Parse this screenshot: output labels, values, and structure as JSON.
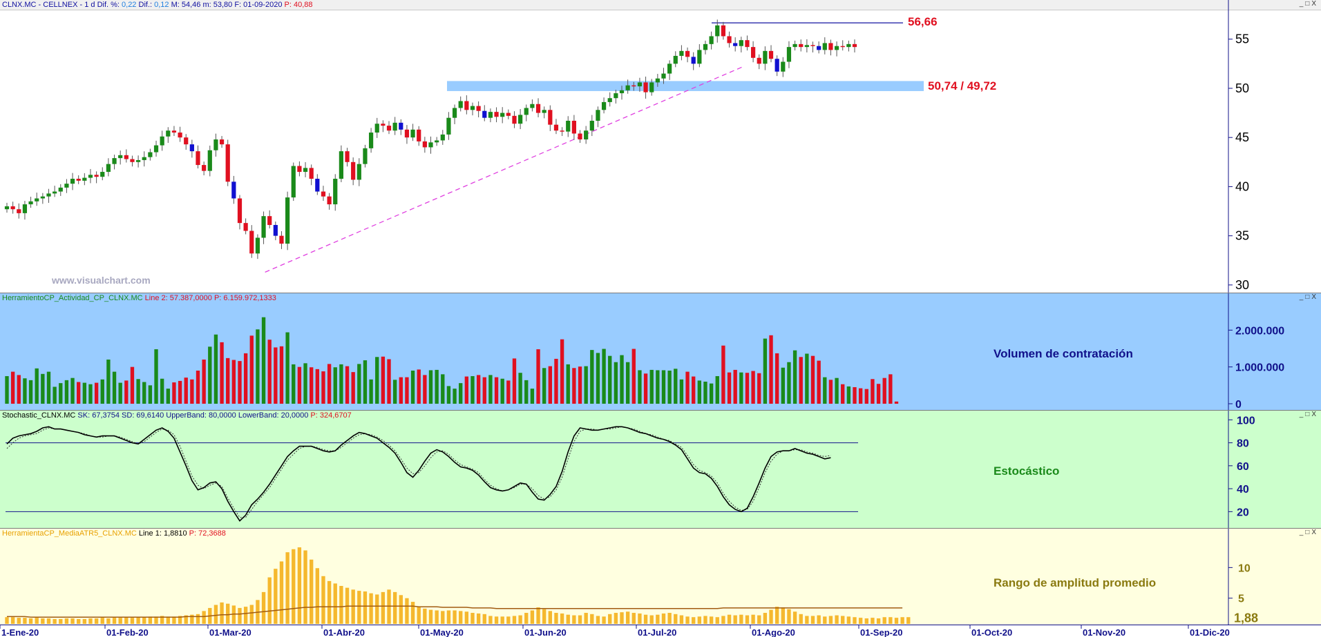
{
  "header": {
    "symbol": "CLNX.MC - CELLNEX - ",
    "period": " 1 d ",
    "dif_pct_label": "Dif. %: ",
    "dif_pct": "0,22",
    "dif_label": " Dif.: ",
    "dif": "0,12",
    "max_label": " M: ",
    "max": "54,46",
    "min_label": " m: ",
    "min": "53,80",
    "date_label": " F: ",
    "date": "01-09-2020",
    "p_label": " P: ",
    "p": "40,88"
  },
  "window_buttons": [
    "_",
    "□",
    "X"
  ],
  "watermark": "www.visualchart.com",
  "annotations": {
    "high_label": "56,66",
    "zone_label": "50,74 / 49,72"
  },
  "panels": {
    "volume": {
      "header": "HerramientoCP_Actividad_CP_CLNX.MC",
      "line_label": " Line 2: 57.387,0000",
      "p_label": " P: 6.159.972,1333",
      "title": "Volumen de contratación",
      "ticks": [
        "2.000.000",
        "1.000.000",
        "0"
      ]
    },
    "stochastic": {
      "header": "Stochastic_CLNX.MC",
      "sk_label": " SK: 67,3754  SD: 69,6140  UpperBand: 80,0000  LowerBand: 20,0000",
      "p_label": " P: 324,6707",
      "title": "Estocástico",
      "ticks": [
        "100",
        "80",
        "60",
        "40",
        "20"
      ]
    },
    "atr": {
      "header": "HerramientaCP_MediaATR5_CLNX.MC",
      "line_label": " Line 1: 1,8810",
      "p_label": " P: 72,3688",
      "title": "Rango de amplitud promedio",
      "ticks": [
        "10",
        "5"
      ],
      "last_value": "1,88"
    }
  },
  "x_axis": {
    "labels": [
      "1-Ene-20",
      "01-Feb-20",
      "01-Mar-20",
      "01-Abr-20",
      "01-May-20",
      "01-Jun-20",
      "01-Jul-20",
      "01-Ago-20",
      "01-Sep-20",
      "01-Oct-20",
      "01-Nov-20",
      "01-Dic-20"
    ]
  },
  "colors": {
    "up": "#1a8a1a",
    "down": "#e01020",
    "down_blue": "#1010d0",
    "volume_bg": "#99ccff",
    "stoch_bg": "#ccffcc",
    "atr_bg": "#ffffe0",
    "atr_bar": "#f5b82e",
    "zone": "#99ccff",
    "trend": "#e040e0",
    "label_red": "#e01020"
  },
  "chart_data": [
    {
      "type": "candlestick",
      "title": "CLNX.MC - CELLNEX",
      "y_ticks": [
        30,
        35,
        40,
        45,
        50,
        55
      ],
      "ylim": [
        29.5,
        58
      ],
      "x_range": [
        "2020-01-02",
        "2020-09-01"
      ],
      "horizontal_line": 56.66,
      "support_zone": [
        49.72,
        50.74
      ],
      "trendline": [
        [
          31.3,
          "2020-03-16"
        ],
        [
          52.2,
          "2020-07-31"
        ]
      ],
      "close": [
        38.0,
        37.7,
        37.3,
        38.2,
        38.5,
        38.8,
        39.0,
        39.3,
        39.5,
        39.9,
        40.3,
        40.8,
        40.6,
        40.9,
        41.2,
        41.0,
        41.5,
        42.3,
        42.9,
        43.2,
        42.8,
        42.5,
        42.7,
        43.0,
        43.5,
        44.2,
        45.1,
        45.7,
        45.5,
        45.0,
        44.3,
        43.6,
        42.2,
        41.6,
        43.7,
        44.8,
        44.3,
        40.5,
        38.8,
        36.3,
        35.5,
        33.2,
        34.8,
        37.0,
        36.1,
        35.0,
        34.2,
        38.9,
        42.1,
        41.5,
        41.9,
        40.8,
        39.5,
        39.0,
        38.2,
        40.8,
        43.6,
        42.5,
        40.7,
        42.3,
        43.9,
        45.5,
        46.4,
        46.2,
        45.7,
        46.5,
        45.8,
        45.0,
        45.8,
        44.6,
        44.0,
        44.5,
        44.7,
        45.3,
        47.0,
        48.0,
        48.7,
        47.8,
        48.2,
        47.7,
        47.0,
        47.6,
        47.1,
        47.5,
        47.2,
        46.4,
        47.3,
        48.0,
        48.4,
        47.5,
        47.8,
        46.3,
        45.7,
        45.6,
        46.7,
        45.4,
        44.8,
        45.7,
        46.7,
        47.8,
        48.6,
        49.0,
        49.5,
        49.8,
        50.3,
        50.2,
        50.6,
        49.6,
        50.6,
        51.0,
        51.5,
        52.5,
        53.3,
        53.8,
        53.2,
        52.5,
        53.9,
        54.5,
        55.3,
        56.4,
        55.3,
        54.6,
        54.3,
        54.9,
        54.2,
        53.1,
        52.5,
        53.8,
        53.0,
        51.7,
        52.7,
        54.2,
        54.5,
        54.2,
        54.4,
        54.3,
        53.9,
        54.6,
        53.9,
        54.3,
        54.2,
        54.5,
        54.2
      ]
    },
    {
      "type": "bar",
      "title": "Volumen de contratación",
      "ylim": [
        0,
        2700000
      ],
      "y_ticks": [
        0,
        1000000,
        2000000
      ],
      "values": [
        750000,
        870000,
        780000,
        690000,
        640000,
        960000,
        810000,
        870000,
        460000,
        560000,
        640000,
        700000,
        590000,
        570000,
        530000,
        570000,
        660000,
        1200000,
        870000,
        570000,
        630000,
        1000000,
        670000,
        590000,
        500000,
        1480000,
        680000,
        410000,
        580000,
        620000,
        710000,
        660000,
        900000,
        1200000,
        1550000,
        1880000,
        1670000,
        1240000,
        1190000,
        1160000,
        1370000,
        1850000,
        2020000,
        2350000,
        1740000,
        1530000,
        1560000,
        1940000,
        1070000,
        1000000,
        1100000,
        990000,
        940000,
        880000,
        1080000,
        990000,
        1070000,
        1020000,
        860000,
        1080000,
        1180000,
        660000,
        1270000,
        1280000,
        1210000,
        650000,
        720000,
        720000,
        900000,
        930000,
        780000,
        910000,
        920000,
        800000,
        480000,
        410000,
        560000,
        740000,
        750000,
        780000,
        720000,
        780000,
        720000,
        680000,
        630000,
        1230000,
        840000,
        640000,
        410000,
        1480000,
        970000,
        1020000,
        1220000,
        1750000,
        1070000,
        970000,
        1010000,
        1020000,
        1460000,
        1380000,
        1490000,
        1300000,
        1130000,
        1320000,
        1130000,
        1490000,
        910000,
        820000,
        920000,
        910000,
        910000,
        900000,
        950000,
        660000,
        870000,
        740000,
        630000,
        600000,
        550000,
        750000,
        1580000,
        850000,
        920000,
        850000,
        840000,
        890000,
        830000,
        1770000,
        1860000,
        1370000,
        980000,
        1130000,
        1450000,
        1270000,
        1360000,
        1300000,
        1170000,
        720000,
        650000,
        700000,
        530000,
        470000,
        450000,
        420000,
        400000,
        670000,
        540000,
        700000,
        800000,
        60000
      ]
    },
    {
      "type": "line",
      "title": "Estocástico",
      "ylim": [
        7,
        102
      ],
      "y_ticks": [
        20,
        40,
        60,
        80,
        100
      ],
      "bands": [
        20,
        80
      ],
      "series": [
        {
          "name": "SK",
          "values": [
            79,
            84,
            86,
            87,
            88,
            90,
            93,
            94,
            92,
            92,
            91,
            90,
            89,
            87,
            86,
            85,
            86,
            86,
            86,
            84,
            82,
            80,
            79,
            83,
            87,
            91,
            93,
            90,
            84,
            72,
            60,
            47,
            39,
            41,
            45,
            46,
            40,
            29,
            20,
            12,
            17,
            26,
            31,
            37,
            44,
            52,
            60,
            68,
            73,
            77,
            77,
            77,
            75,
            73,
            72,
            73,
            78,
            82,
            86,
            89,
            88,
            86,
            84,
            80,
            76,
            71,
            63,
            54,
            50,
            56,
            64,
            71,
            74,
            72,
            68,
            63,
            59,
            58,
            56,
            52,
            46,
            41,
            39,
            38,
            39,
            42,
            45,
            44,
            37,
            31,
            30,
            35,
            42,
            55,
            72,
            86,
            93,
            92,
            91,
            91,
            92,
            93,
            94,
            94,
            93,
            91,
            89,
            88,
            86,
            84,
            83,
            81,
            78,
            74,
            66,
            58,
            54,
            53,
            49,
            42,
            33,
            26,
            22,
            20,
            23,
            33,
            45,
            58,
            68,
            72,
            73,
            73,
            75,
            73,
            71,
            70,
            68,
            66,
            67
          ]
        },
        {
          "name": "SD",
          "values": [
            75,
            80,
            84,
            86,
            87,
            88,
            91,
            93,
            92,
            92,
            91,
            90,
            89,
            88,
            86,
            85,
            85,
            86,
            86,
            85,
            83,
            81,
            79,
            81,
            85,
            89,
            92,
            91,
            87,
            77,
            64,
            51,
            43,
            40,
            43,
            45,
            42,
            32,
            23,
            15,
            15,
            22,
            29,
            35,
            41,
            49,
            57,
            65,
            70,
            75,
            77,
            77,
            76,
            74,
            73,
            73,
            76,
            80,
            84,
            87,
            88,
            87,
            85,
            82,
            78,
            73,
            66,
            58,
            53,
            54,
            60,
            67,
            72,
            73,
            70,
            65,
            61,
            59,
            57,
            54,
            48,
            43,
            40,
            38,
            39,
            41,
            44,
            44,
            40,
            34,
            31,
            33,
            39,
            50,
            66,
            81,
            90,
            92,
            92,
            91,
            92,
            92,
            93,
            94,
            93,
            92,
            90,
            88,
            87,
            85,
            83,
            82,
            79,
            76,
            69,
            61,
            56,
            54,
            51,
            45,
            36,
            29,
            24,
            21,
            22,
            29,
            41,
            54,
            64,
            70,
            73,
            73,
            74,
            74,
            72,
            71,
            69,
            68,
            69
          ]
        }
      ]
    },
    {
      "type": "bar",
      "title": "Rango de amplitud promedio",
      "ylim": [
        0.8,
        15
      ],
      "y_ticks": [
        5,
        10
      ],
      "last_value": 1.88,
      "values": [
        1.9,
        1.9,
        1.8,
        1.8,
        1.7,
        1.8,
        1.7,
        1.7,
        1.6,
        1.6,
        1.7,
        1.7,
        1.6,
        1.6,
        1.7,
        1.7,
        1.8,
        1.7,
        1.8,
        1.8,
        1.9,
        1.8,
        1.9,
        1.9,
        2.0,
        2.0,
        2.1,
        2.0,
        2.0,
        2.1,
        2.2,
        2.3,
        2.4,
        2.9,
        3.4,
        3.9,
        4.3,
        4.1,
        3.8,
        3.4,
        3.6,
        3.9,
        4.7,
        6.0,
        8.4,
        9.8,
        11.0,
        12.5,
        13.0,
        13.3,
        12.8,
        11.3,
        9.9,
        8.6,
        7.8,
        7.4,
        7.0,
        6.7,
        6.4,
        6.2,
        6.1,
        5.8,
        5.6,
        6.0,
        6.4,
        6.0,
        5.5,
        5.0,
        4.4,
        3.6,
        3.3,
        3.1,
        3.0,
        2.9,
        3.0,
        3.0,
        2.9,
        2.8,
        2.6,
        2.5,
        2.4,
        2.1,
        2.0,
        2.0,
        2.0,
        2.1,
        2.2,
        2.6,
        3.0,
        3.5,
        3.2,
        2.9,
        2.6,
        2.5,
        2.3,
        2.2,
        2.2,
        2.6,
        2.4,
        2.1,
        2.0,
        2.4,
        2.6,
        2.7,
        2.8,
        2.6,
        2.5,
        2.3,
        2.2,
        2.3,
        2.5,
        2.6,
        2.4,
        2.2,
        2.0,
        1.9,
        2.0,
        2.1,
        2.0,
        1.9,
        2.1,
        2.3,
        2.2,
        2.3,
        2.2,
        2.3,
        2.2,
        2.6,
        3.1,
        3.6,
        3.5,
        3.2,
        2.8,
        2.4,
        2.1,
        2.1,
        2.2,
        2.0,
        2.1,
        2.2,
        2.1,
        2.0,
        1.9,
        1.8,
        1.7,
        1.8,
        1.7,
        1.9,
        1.9,
        1.8,
        1.9,
        1.9
      ],
      "ma": [
        2.0,
        2.0,
        2.0,
        2.0,
        1.9,
        1.9,
        1.9,
        1.9,
        1.9,
        1.9,
        1.9,
        1.9,
        1.9,
        1.9,
        1.9,
        1.9,
        1.9,
        1.9,
        1.9,
        1.9,
        1.9,
        1.9,
        1.9,
        1.9,
        1.9,
        1.9,
        1.9,
        1.9,
        1.9,
        1.9,
        2.0,
        2.0,
        2.0,
        2.0,
        2.1,
        2.2,
        2.3,
        2.3,
        2.4,
        2.4,
        2.5,
        2.6,
        2.7,
        2.8,
        2.9,
        3.0,
        3.1,
        3.2,
        3.3,
        3.4,
        3.5,
        3.5,
        3.6,
        3.6,
        3.6,
        3.6,
        3.6,
        3.7,
        3.7,
        3.7,
        3.7,
        3.7,
        3.7,
        3.7,
        3.7,
        3.7,
        3.7,
        3.7,
        3.7,
        3.6,
        3.6,
        3.6,
        3.6,
        3.5,
        3.5,
        3.5,
        3.5,
        3.5,
        3.4,
        3.4,
        3.4,
        3.4,
        3.3,
        3.3,
        3.3,
        3.3,
        3.3,
        3.3,
        3.3,
        3.3,
        3.3,
        3.3,
        3.3,
        3.3,
        3.3,
        3.3,
        3.3,
        3.3,
        3.3,
        3.3,
        3.3,
        3.3,
        3.3,
        3.3,
        3.3,
        3.3,
        3.3,
        3.3,
        3.3,
        3.3,
        3.3,
        3.3,
        3.3,
        3.3,
        3.3,
        3.3,
        3.3,
        3.3,
        3.3,
        3.3,
        3.4,
        3.4,
        3.4,
        3.4,
        3.4,
        3.4,
        3.4,
        3.4,
        3.4,
        3.4,
        3.4,
        3.4,
        3.4,
        3.4,
        3.4,
        3.4,
        3.4,
        3.4,
        3.4,
        3.4,
        3.4,
        3.4,
        3.4,
        3.4,
        3.4,
        3.4,
        3.4,
        3.4,
        3.4,
        3.4,
        3.4
      ]
    }
  ]
}
